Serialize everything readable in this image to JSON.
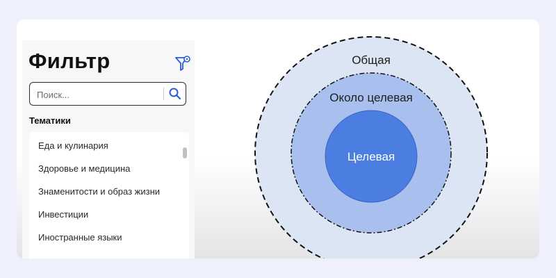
{
  "filter_panel": {
    "title": "Фильтр",
    "filter_icon": "filter-settings-icon",
    "search": {
      "placeholder": "Поиск...",
      "value": "",
      "icon": "search-icon"
    },
    "section_label": "Тематики",
    "topics": [
      "Еда и кулинария",
      "Здоровье и медицина",
      "Знаменитости и образ жизни",
      "Инвестиции",
      "Иностранные языки"
    ]
  },
  "audience_diagram": {
    "outer_label": "Общая",
    "middle_label": "Около целевая",
    "inner_label": "Целевая"
  },
  "colors": {
    "accent": "#2a5cd6",
    "outer_ring": "#dbe5f4",
    "middle_ring": "#a9c0ee",
    "inner_circle": "#4b7ee0"
  }
}
